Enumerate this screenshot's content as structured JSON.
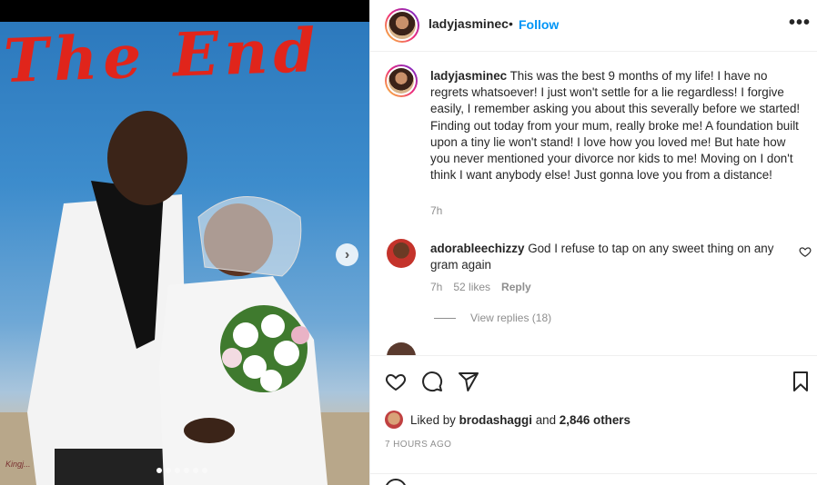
{
  "media": {
    "overlay_text": "The End",
    "watermark": "Kingj...",
    "carousel": {
      "count": 6,
      "active_index": 0
    },
    "next_icon": "chevron-right-icon"
  },
  "header": {
    "username": "ladyjasminec",
    "separator": "•",
    "follow_label": "Follow",
    "more_icon": "more-horizontal-icon",
    "more_label": "•••"
  },
  "caption": {
    "username": "ladyjasminec",
    "text": "This was the best 9 months of my life! I have no regrets whatsoever! I just won't settle for a lie regardless! I forgive easily, I remember asking you about this severally before we started! Finding out today from your mum, really broke me! A foundation built upon a tiny lie won't stand! I love how you loved me! But hate how you never mentioned your divorce nor kids to me! Moving on I don't think I want anybody else! Just gonna love you from a distance!",
    "time": "7h"
  },
  "comments": [
    {
      "username": "adorableechizzy",
      "text": "God I refuse to tap on any sweet thing on any gram again",
      "time": "7h",
      "likes": "52 likes",
      "reply_label": "Reply",
      "view_replies": "View replies (18)"
    }
  ],
  "peek_comment": "",
  "actions": {
    "icons": [
      "heart-icon",
      "comment-icon",
      "share-icon",
      "bookmark-icon"
    ]
  },
  "likes": {
    "prefix": "Liked by",
    "liker": "brodashaggi",
    "connector": "and",
    "others": "2,846 others"
  },
  "post_time": "7 HOURS AGO",
  "colors": {
    "follow_blue": "#0095f6",
    "muted": "#8e8e8e",
    "text": "#262626",
    "overlay_red": "#e0251b"
  }
}
